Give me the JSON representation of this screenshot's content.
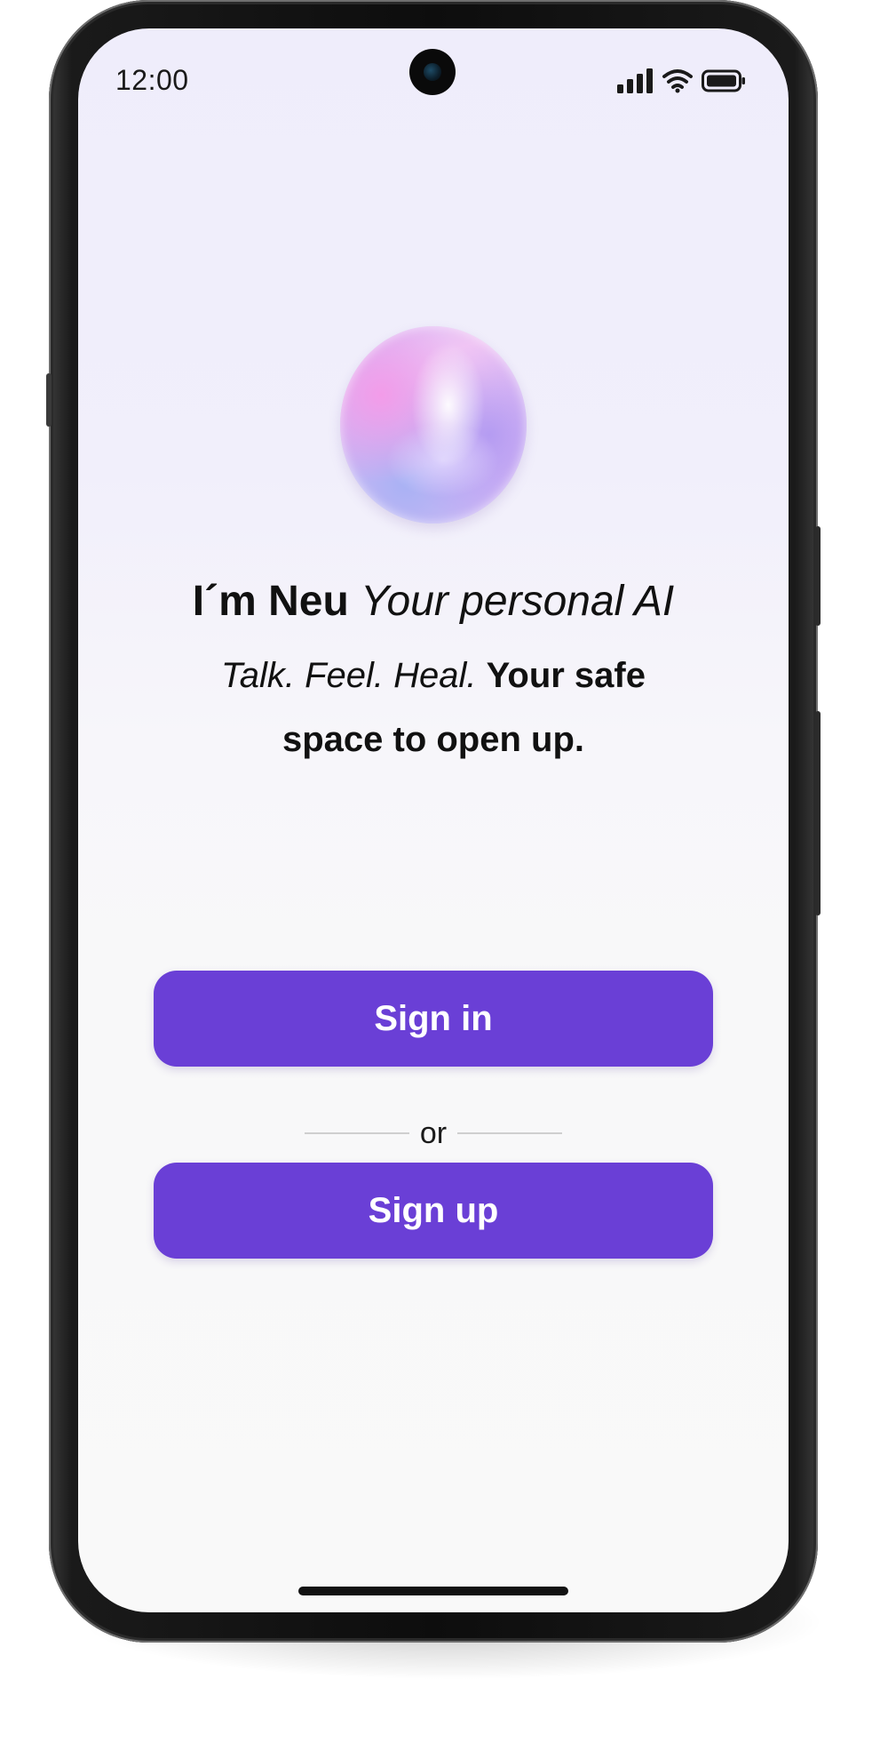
{
  "status_bar": {
    "time": "12:00"
  },
  "hero": {
    "name_bold": "I´m Neu",
    "name_italic": "Your personal AI",
    "tagline_italic": "Talk. Feel. Heal.",
    "tagline_bold": "Your safe space to open up."
  },
  "auth": {
    "sign_in_label": "Sign in",
    "divider_label": "or",
    "sign_up_label": "Sign up"
  },
  "colors": {
    "accent": "#6a3fd6",
    "text": "#111111"
  },
  "icons": [
    "signal-icon",
    "wifi-icon",
    "battery-icon"
  ]
}
